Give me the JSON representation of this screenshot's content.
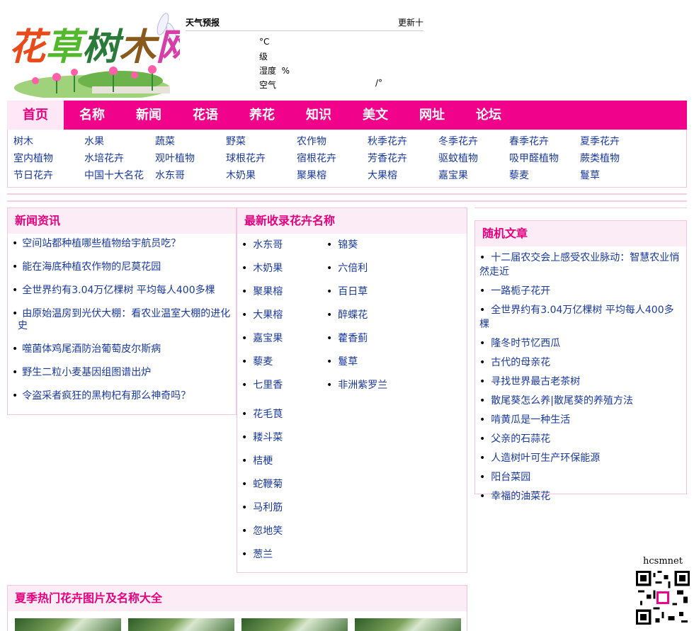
{
  "logo": {
    "text": "花草树木网"
  },
  "weather": {
    "title": "天气预报",
    "update": "更新十",
    "temp_unit": "°C",
    "wind_unit": "级",
    "humidity_label": "湿度",
    "humidity_unit": "%",
    "air_label": "空气",
    "air_slash": "/°"
  },
  "nav": [
    {
      "label": "首页",
      "active": true
    },
    {
      "label": "名称"
    },
    {
      "label": "新闻"
    },
    {
      "label": "花语"
    },
    {
      "label": "养花"
    },
    {
      "label": "知识"
    },
    {
      "label": "美文"
    },
    {
      "label": "网址"
    },
    {
      "label": "论坛"
    }
  ],
  "subcats": [
    [
      "树木",
      "水果",
      "蔬菜",
      "野菜",
      "农作物",
      "秋季花卉",
      "冬季花卉",
      "春季花卉",
      "夏季花卉"
    ],
    [
      "室内植物",
      "水培花卉",
      "观叶植物",
      "球根花卉",
      "宿根花卉",
      "芳香花卉",
      "驱蚊植物",
      "吸甲醛植物",
      "蕨类植物"
    ],
    [
      "节日花卉",
      "中国十大名花",
      "水东哥",
      "木奶果",
      "聚果榕",
      "大果榕",
      "嘉宝果",
      "藜麦",
      "鬘草"
    ]
  ],
  "news": {
    "title": "新闻资讯",
    "items": [
      "空间站都种植哪些植物给宇航员吃？",
      "能在海底种植农作物的尼莫花园",
      "全世界约有3.04万亿棵树  平均每人400多棵",
      "由原始温房到光伏大棚：看农业温室大棚的进化史",
      "噬菌体鸡尾酒防治葡萄皮尔斯病",
      "野生二粒小麦基因组图谱出炉",
      "令盗采者疯狂的黑枸杞有那么神奇吗？"
    ]
  },
  "newflowers": {
    "title": "最新收录花卉名称",
    "col1": [
      "水东哥",
      "木奶果",
      "聚果榕",
      "大果榕",
      "嘉宝果",
      "藜麦",
      "七里香"
    ],
    "col2": [
      "锦葵",
      "六倍利",
      "百日草",
      "醉蝶花",
      "藿香蓟",
      "鬘草",
      "非洲紫罗兰"
    ],
    "col3": [
      "花毛茛",
      "耧斗菜",
      "桔梗",
      "蛇鞭菊",
      "马利筋",
      "忽地笑",
      "葱兰"
    ]
  },
  "random": {
    "title": "随机文章",
    "items": [
      "十二届农交会上感受农业脉动：智慧农业悄然走近",
      "一路栀子花开",
      "全世界约有3.04万亿棵树  平均每人400多棵",
      "隆冬时节忆西瓜",
      "古代的母亲花",
      "寻找世界最古老茶树",
      "散尾葵怎么养|散尾葵的养殖方法",
      "啃黄瓜是一种生活",
      "父亲的石蒜花",
      "人造树叶可生产环保能源",
      "阳台菜园",
      "幸福的油菜花"
    ]
  },
  "summer": {
    "title": "夏季热门花卉图片及名称大全"
  },
  "qr": {
    "label": "hcsmnet"
  },
  "colors": {
    "accent": "#f0038a",
    "link": "#1a3a9c",
    "title": "#e6007e"
  }
}
